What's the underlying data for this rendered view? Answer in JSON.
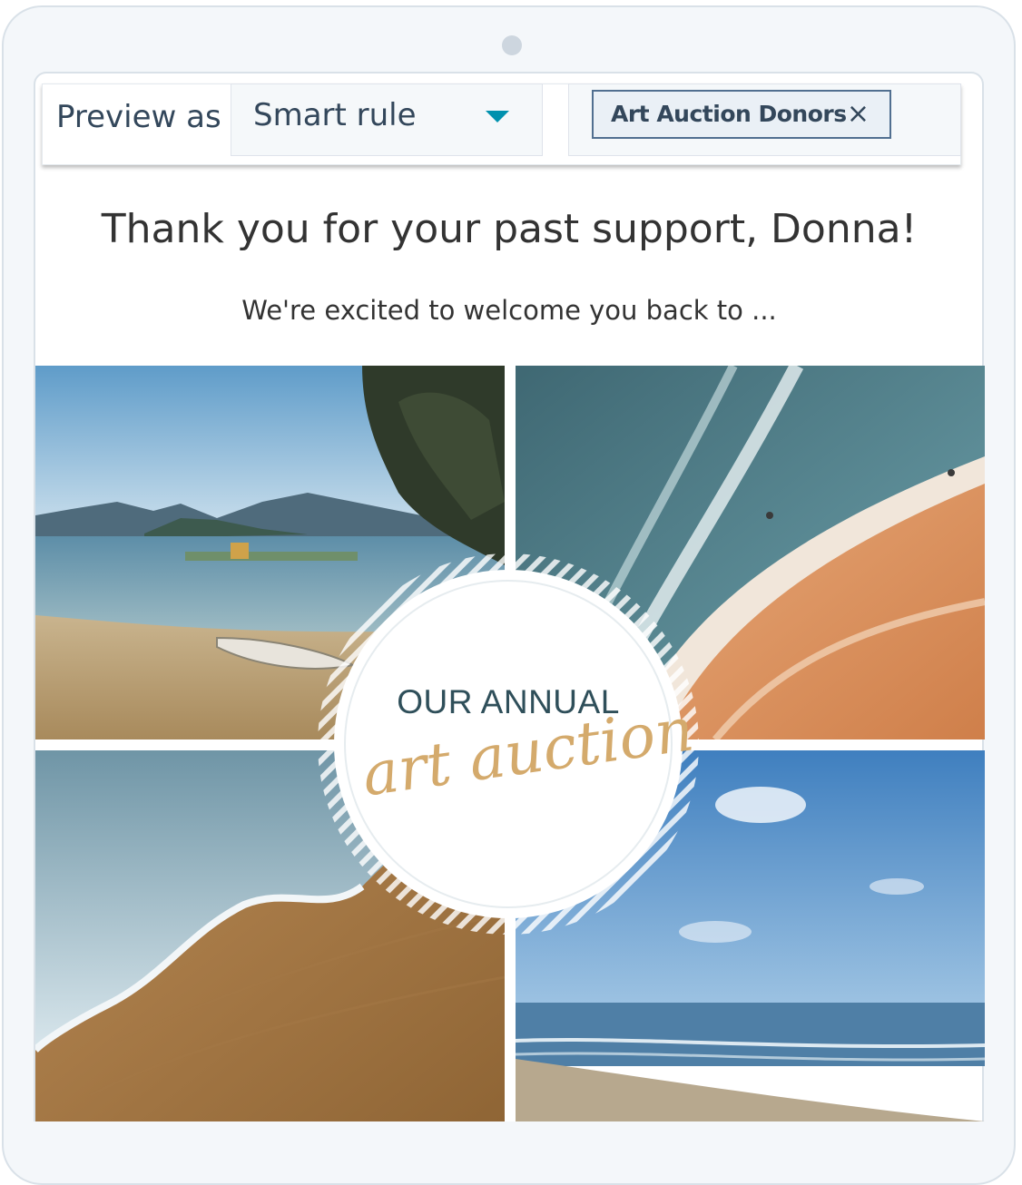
{
  "toolbar": {
    "preview_label": "Preview as",
    "rule_select": {
      "value": "Smart rule",
      "icon": "caret-down-icon"
    },
    "tag": {
      "label": "Art Auction Donors",
      "remove_icon": "×"
    }
  },
  "content": {
    "headline": "Thank you for your past support, Donna!",
    "subline": "We're excited to welcome you back to ...",
    "badge": {
      "top_text": "OUR ANNUAL",
      "script_text": "art auction"
    }
  },
  "colors": {
    "accent": "#0091ae",
    "tag_border": "#516f90",
    "text": "#33475b",
    "script": "#d4aa6c"
  }
}
